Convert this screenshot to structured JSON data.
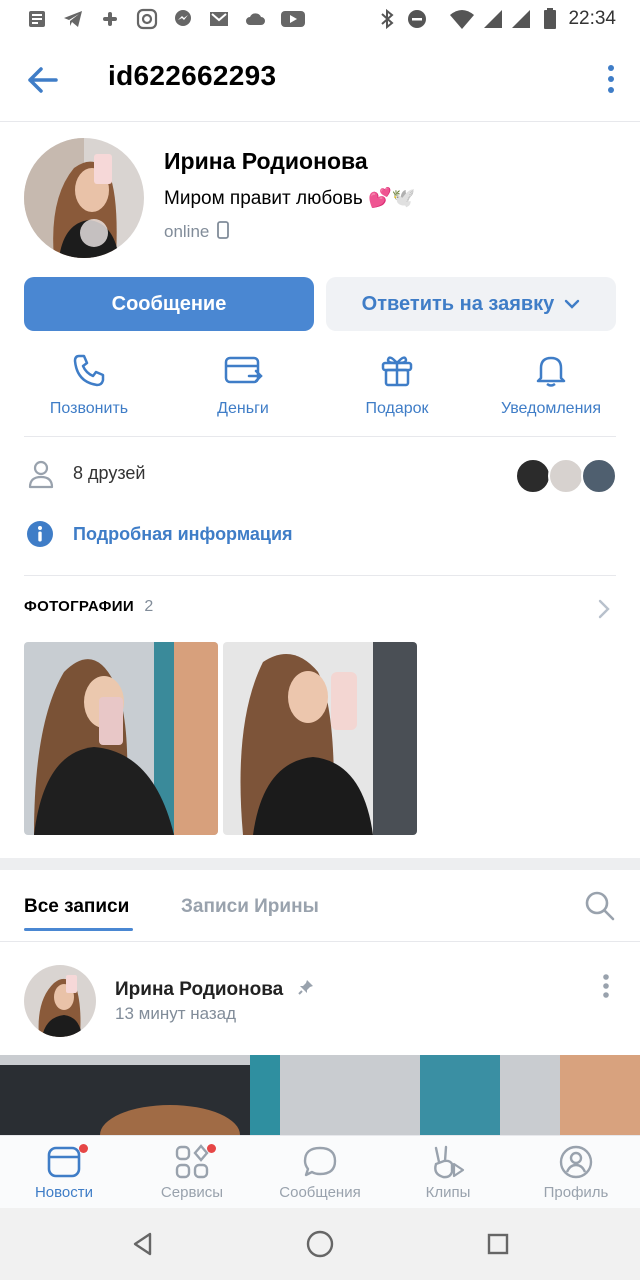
{
  "status_bar": {
    "time": "22:34",
    "left_icons": [
      "news-icon",
      "telegram-icon",
      "slack-icon",
      "instagram-icon",
      "messenger-icon",
      "gmail-icon",
      "cloud-icon",
      "youtube-icon"
    ],
    "right_icons": [
      "bluetooth-icon",
      "dnd-icon",
      "wifi-icon",
      "signal-icon",
      "signal-icon",
      "battery-icon"
    ]
  },
  "header": {
    "title": "id622662293"
  },
  "profile": {
    "name": "Ирина Родионова",
    "status": "Миром правит любовь 💕🕊️",
    "online": "online"
  },
  "buttons": {
    "message": "Сообщение",
    "reply": "Ответить на заявку"
  },
  "actions": [
    {
      "label": "Позвонить",
      "icon": "phone-icon"
    },
    {
      "label": "Деньги",
      "icon": "money-icon"
    },
    {
      "label": "Подарок",
      "icon": "gift-icon"
    },
    {
      "label": "Уведомления",
      "icon": "bell-icon"
    }
  ],
  "friends": {
    "text": "8 друзей"
  },
  "info": {
    "text": "Подробная информация"
  },
  "photos": {
    "title": "ФОТОГРАФИИ",
    "count": "2"
  },
  "tabs": {
    "all": "Все записи",
    "own": "Записи Ирины"
  },
  "post": {
    "author": "Ирина Родионова",
    "time": "13 минут назад"
  },
  "bottom_nav": [
    {
      "label": "Новости",
      "icon": "news-icon",
      "active": true,
      "badge": true
    },
    {
      "label": "Сервисы",
      "icon": "services-icon",
      "active": false,
      "badge": true
    },
    {
      "label": "Сообщения",
      "icon": "messages-icon",
      "active": false,
      "badge": false
    },
    {
      "label": "Клипы",
      "icon": "clips-icon",
      "active": false,
      "badge": false
    },
    {
      "label": "Профиль",
      "icon": "profile-icon",
      "active": false,
      "badge": false
    }
  ],
  "colors": {
    "accent": "#4a87d2",
    "link": "#3f7dc7",
    "secondary_text": "#818c99",
    "badge": "#e64646"
  }
}
